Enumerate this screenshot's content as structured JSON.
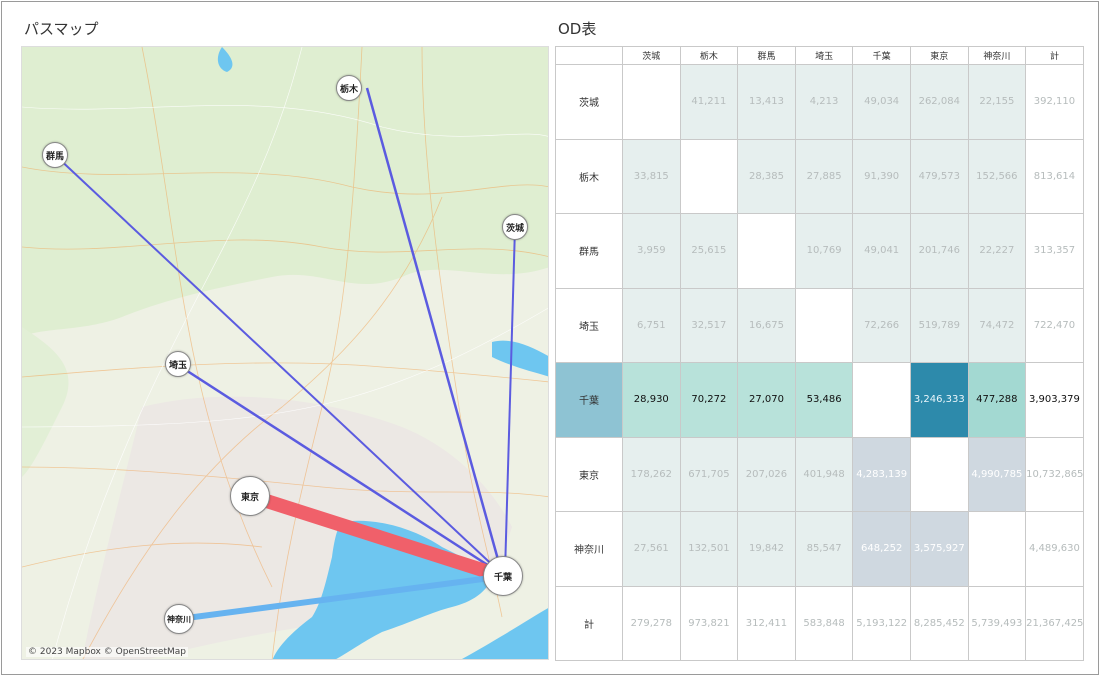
{
  "map_panel": {
    "title": "パスマップ",
    "attribution": "© 2023 Mapbox © OpenStreetMap",
    "nodes": {
      "tochigi": "栃木",
      "gunma": "群馬",
      "ibaraki": "茨城",
      "saitama": "埼玉",
      "tokyo": "東京",
      "chiba": "千葉",
      "kanagawa": "神奈川"
    },
    "colors": {
      "line_purple": "#5b5be0",
      "line_red": "#f0606a",
      "line_blue": "#66b3f0",
      "water": "#6ec6f0"
    }
  },
  "od_table": {
    "title": "OD表",
    "columns": [
      "茨城",
      "栃木",
      "群馬",
      "埼玉",
      "千葉",
      "東京",
      "神奈川",
      "計"
    ],
    "rows": [
      {
        "label": "茨城",
        "cells": [
          "",
          "41,211",
          "13,413",
          "4,213",
          "49,034",
          "262,084",
          "22,155",
          "392,110"
        ]
      },
      {
        "label": "栃木",
        "cells": [
          "33,815",
          "",
          "28,385",
          "27,885",
          "91,390",
          "479,573",
          "152,566",
          "813,614"
        ]
      },
      {
        "label": "群馬",
        "cells": [
          "3,959",
          "25,615",
          "",
          "10,769",
          "49,041",
          "201,746",
          "22,227",
          "313,357"
        ]
      },
      {
        "label": "埼玉",
        "cells": [
          "6,751",
          "32,517",
          "16,675",
          "",
          "72,266",
          "519,789",
          "74,472",
          "722,470"
        ]
      },
      {
        "label": "千葉",
        "cells": [
          "28,930",
          "70,272",
          "27,070",
          "53,486",
          "",
          "3,246,333",
          "477,288",
          "3,903,379"
        ]
      },
      {
        "label": "東京",
        "cells": [
          "178,262",
          "671,705",
          "207,026",
          "401,948",
          "4,283,139",
          "",
          "4,990,785",
          "10,732,865"
        ]
      },
      {
        "label": "神奈川",
        "cells": [
          "27,561",
          "132,501",
          "19,842",
          "85,547",
          "648,252",
          "3,575,927",
          "",
          "4,489,630"
        ]
      },
      {
        "label": "計",
        "cells": [
          "279,278",
          "973,821",
          "312,411",
          "583,848",
          "5,193,122",
          "8,285,452",
          "5,739,493",
          "21,367,425"
        ]
      }
    ],
    "colors": {
      "light_cell": "#e6efee",
      "chiba_label": "#8ec3d3",
      "chiba_cell": "#b8e2da",
      "chiba_tokyo": "#2d8aab",
      "chiba_kanagawa": "#a3d9d2",
      "gray_cell": "#cfd8e0"
    }
  }
}
